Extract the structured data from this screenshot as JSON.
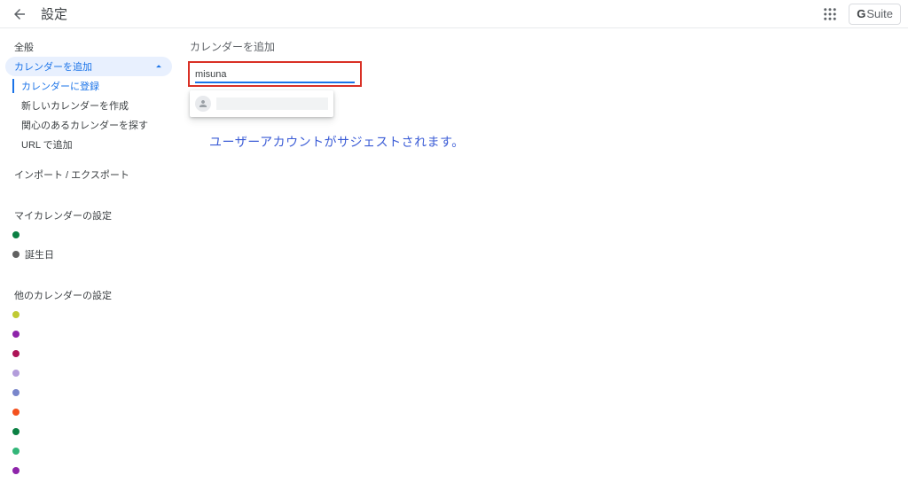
{
  "header": {
    "title": "設定",
    "gsuite_prefix": "G",
    "gsuite_suffix": " Suite"
  },
  "sidebar": {
    "general": "全般",
    "add_calendar": "カレンダーを追加",
    "add_children": {
      "subscribe": "カレンダーに登録",
      "create_new": "新しいカレンダーを作成",
      "browse_interest": "関心のあるカレンダーを探す",
      "by_url": "URL で追加"
    },
    "import_export": "インポート / エクスポート",
    "my_cal_heading": "マイカレンダーの設定",
    "my_calendars": [
      {
        "color": "#0b8043",
        "label": ""
      },
      {
        "color": "#616161",
        "label": "誕生日"
      }
    ],
    "other_cal_heading": "他のカレンダーの設定",
    "other_calendars": [
      {
        "color": "#c0ca33"
      },
      {
        "color": "#8e24aa"
      },
      {
        "color": "#ad1457"
      },
      {
        "color": "#b39ddb"
      },
      {
        "color": "#7986cb"
      },
      {
        "color": "#f4511e"
      },
      {
        "color": "#0b8043"
      },
      {
        "color": "#33b679"
      },
      {
        "color": "#8e24aa"
      }
    ]
  },
  "content": {
    "heading": "カレンダーを追加",
    "input_value": "misuna",
    "annotation": "ユーザーアカウントがサジェストされます。"
  }
}
